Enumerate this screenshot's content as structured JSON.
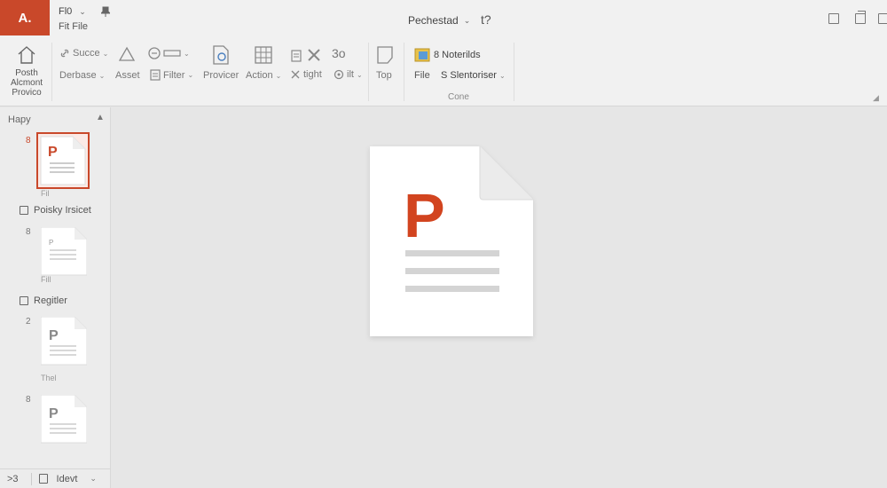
{
  "titlebar": {
    "app_logo": "A.",
    "file_menu": "Fl0",
    "file_sub": "Fit File",
    "doc_title": "Pechestad",
    "help_label": "t?"
  },
  "ribbon": {
    "big_button": {
      "line1": "Posth",
      "line2": "Alcmont",
      "line3": "Provico"
    },
    "row1": {
      "succe": "Succe",
      "bo": "3o",
      "notebook": "8 Noterilds"
    },
    "row2": {
      "derbase": "Derbase",
      "asset": "Asset",
      "filter": "Filter",
      "provicer": "Provicer",
      "action": "Action",
      "tight": "tight",
      "ilt": "ilt",
      "top": "Top",
      "file": "File",
      "slentoriser": "S Slentoriser"
    },
    "group_label": "Cone"
  },
  "pane": {
    "header": "Hapy",
    "slides": [
      {
        "num": "8",
        "caption": "Fil"
      },
      {
        "num": "8",
        "caption": "Fill"
      },
      {
        "num": "2",
        "caption": "Thel"
      },
      {
        "num": "8",
        "caption": ""
      }
    ],
    "sections": [
      "Poisky Irsicet",
      "Regitler"
    ],
    "footer": {
      "label": ">3",
      "view": "Idevt"
    }
  },
  "colors": {
    "accent": "#c9482a",
    "background": "#e6e6e6",
    "chrome": "#f1f1f1"
  },
  "hero": {
    "letter": "P"
  }
}
